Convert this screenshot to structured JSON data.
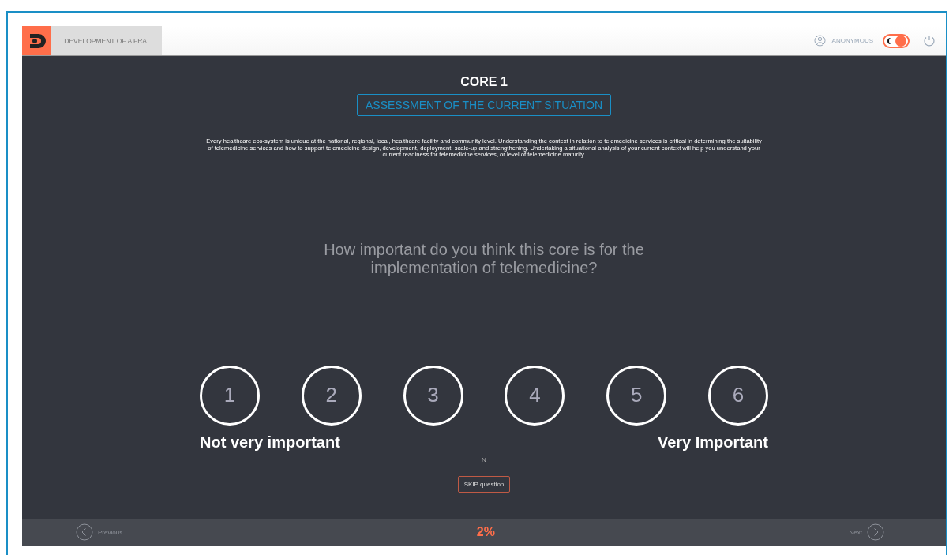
{
  "header": {
    "tab_title": "DEVELOPMENT OF A FRA ...",
    "user": "ANONYMOUS",
    "theme_toggle": {
      "on": true
    }
  },
  "core": {
    "title": "CORE 1",
    "subtitle": "ASSESSMENT OF THE CURRENT SITUATION",
    "description": "Every healthcare eco-system is unique at the national, regional, local, healthcare facility and community level. Understanding the context in relation to telemedicine services is critical in determining the suitability of telemedicine services and how to support telemedicine design, development, deployment, scale-up and strengthening. Undertaking a situational analysis of your current context will help you understand your current readiness for telemedicine services, or level of telemedicine maturity."
  },
  "question": "How important do you think this core is for the implementation of telemedicine?",
  "rating": {
    "options": [
      {
        "label": "1",
        "selected": false
      },
      {
        "label": "2",
        "selected": false
      },
      {
        "label": "3",
        "selected": false
      },
      {
        "label": "4",
        "selected": false
      },
      {
        "label": "5",
        "selected": false
      },
      {
        "label": "6",
        "selected": false
      }
    ],
    "min_label": "Not very important",
    "max_label": "Very Important"
  },
  "answer_marker": "N",
  "skip_button": "SKIP question",
  "footer": {
    "previous": {
      "label": "Previous",
      "disabled": true
    },
    "progress": "2%",
    "next": {
      "label": "Next",
      "disabled": true
    }
  }
}
